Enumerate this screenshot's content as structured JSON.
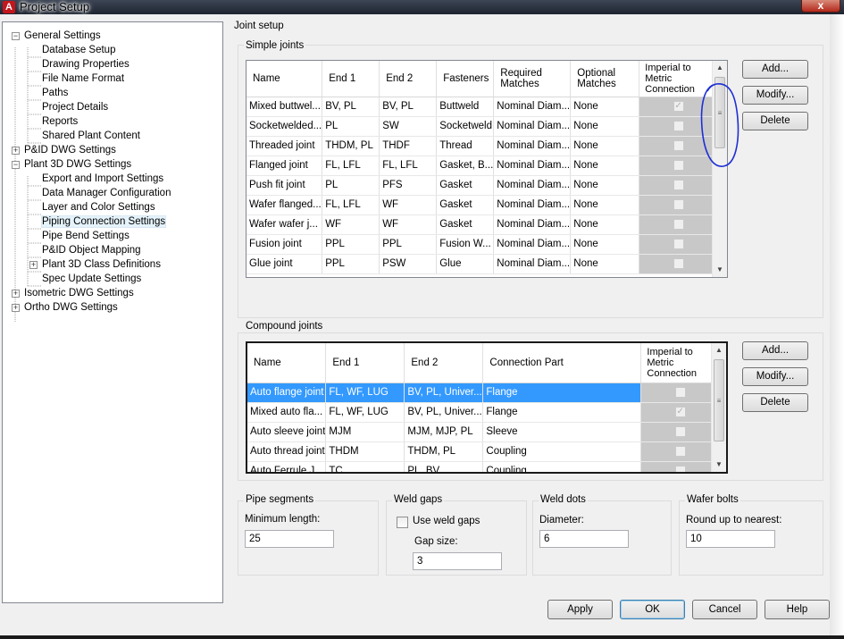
{
  "window": {
    "title": "Project Setup",
    "app_icon": "A",
    "close_glyph": "x"
  },
  "tree": {
    "items": [
      {
        "label": "General Settings",
        "expander": "−"
      },
      {
        "label": "Database Setup"
      },
      {
        "label": "Drawing Properties"
      },
      {
        "label": "File Name Format"
      },
      {
        "label": "Paths"
      },
      {
        "label": "Project Details"
      },
      {
        "label": "Reports"
      },
      {
        "label": "Shared Plant Content"
      },
      {
        "label": "P&ID DWG Settings",
        "expander": "+"
      },
      {
        "label": "Plant 3D DWG Settings",
        "expander": "−"
      },
      {
        "label": "Export and Import Settings"
      },
      {
        "label": "Data Manager Configuration"
      },
      {
        "label": "Layer and Color Settings"
      },
      {
        "label": "Piping Connection Settings",
        "selected": true
      },
      {
        "label": "Pipe Bend Settings"
      },
      {
        "label": "P&ID Object Mapping"
      },
      {
        "label": "Plant 3D Class Definitions",
        "expander": "+"
      },
      {
        "label": "Spec Update Settings"
      },
      {
        "label": "Isometric DWG Settings",
        "expander": "+"
      },
      {
        "label": "Ortho DWG Settings",
        "expander": "+"
      }
    ]
  },
  "joint_setup": {
    "title": "Joint setup",
    "simple": {
      "title": "Simple joints",
      "headers": [
        "Name",
        "End 1",
        "End 2",
        "Fasteners",
        "Required Matches",
        "Optional Matches",
        "Imperial to Metric Connection"
      ],
      "rows": [
        [
          "Mixed buttwel...",
          "BV, PL",
          "BV, PL",
          "Buttweld",
          "Nominal Diam...",
          "None",
          true
        ],
        [
          "Socketwelded...",
          "PL",
          "SW",
          "Socketweld",
          "Nominal Diam...",
          "None",
          false
        ],
        [
          "Threaded joint",
          "THDM, PL",
          "THDF",
          "Thread",
          "Nominal Diam...",
          "None",
          false
        ],
        [
          "Flanged joint",
          "FL, LFL",
          "FL, LFL",
          "Gasket, B...",
          "Nominal Diam...",
          "None",
          false
        ],
        [
          "Push fit joint",
          "PL",
          "PFS",
          "Gasket",
          "Nominal Diam...",
          "None",
          false
        ],
        [
          "Wafer flanged...",
          "FL, LFL",
          "WF",
          "Gasket",
          "Nominal Diam...",
          "None",
          false
        ],
        [
          "Wafer wafer j...",
          "WF",
          "WF",
          "Gasket",
          "Nominal Diam...",
          "None",
          false
        ],
        [
          "Fusion joint",
          "PPL",
          "PPL",
          "Fusion W...",
          "Nominal Diam...",
          "None",
          false
        ],
        [
          "Glue joint",
          "PPL",
          "PSW",
          "Glue",
          "Nominal Diam...",
          "None",
          false
        ]
      ],
      "buttons": {
        "add": "Add...",
        "modify": "Modify...",
        "delete": "Delete"
      }
    },
    "compound": {
      "title": "Compound joints",
      "headers": [
        "Name",
        "End 1",
        "End 2",
        "Connection Part",
        "Imperial to Metric Connection"
      ],
      "rows": [
        [
          "Auto flange joint",
          "FL, WF, LUG",
          "BV, PL, Univer...",
          "Flange",
          false
        ],
        [
          "Mixed auto fla...",
          "FL, WF, LUG",
          "BV, PL, Univer...",
          "Flange",
          true
        ],
        [
          "Auto sleeve joint",
          "MJM",
          "MJM, MJP, PL",
          "Sleeve",
          false
        ],
        [
          "Auto thread joint",
          "THDM",
          "THDM, PL",
          "Coupling",
          false
        ],
        [
          "Auto Ferrule J...",
          "TC",
          "PL, BV...",
          "Coupling",
          false
        ]
      ],
      "selected_row": 0,
      "buttons": {
        "add": "Add...",
        "modify": "Modify...",
        "delete": "Delete"
      }
    }
  },
  "pipe_segments": {
    "title": "Pipe segments",
    "label": "Minimum length:",
    "value": "25"
  },
  "weld_gaps": {
    "title": "Weld gaps",
    "checkbox_label": "Use weld gaps",
    "checked": false,
    "gap_label": "Gap size:",
    "gap_value": "3"
  },
  "weld_dots": {
    "title": "Weld dots",
    "label": "Diameter:",
    "value": "6"
  },
  "wafer_bolts": {
    "title": "Wafer bolts",
    "label": "Round up to nearest:",
    "value": "10"
  },
  "footer": {
    "apply": "Apply",
    "ok": "OK",
    "cancel": "Cancel",
    "help": "Help"
  },
  "scroll_glyphs": {
    "up": "▲",
    "down": "▼",
    "grip": "≡"
  },
  "colors": {
    "selection": "#3399ff",
    "annotation": "#1f2fd4",
    "checkbox_column": "#c8c8c8"
  }
}
